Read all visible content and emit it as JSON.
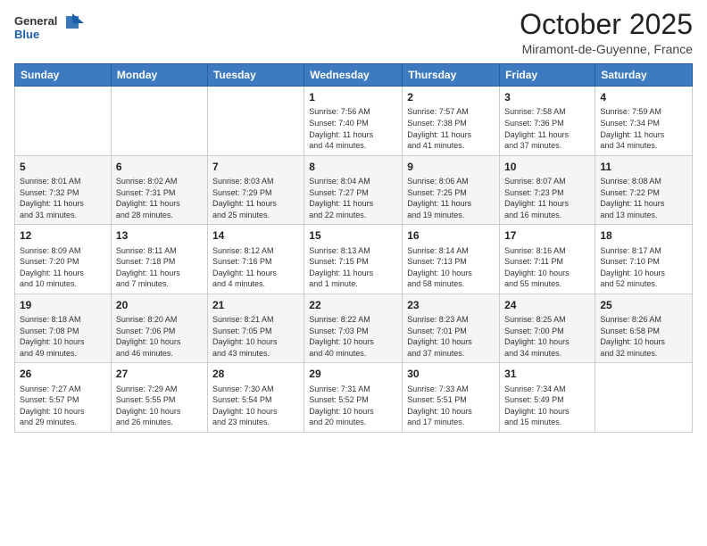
{
  "logo": {
    "general": "General",
    "blue": "Blue"
  },
  "header": {
    "month": "October 2025",
    "location": "Miramont-de-Guyenne, France"
  },
  "weekdays": [
    "Sunday",
    "Monday",
    "Tuesday",
    "Wednesday",
    "Thursday",
    "Friday",
    "Saturday"
  ],
  "weeks": [
    [
      {
        "day": "",
        "info": ""
      },
      {
        "day": "",
        "info": ""
      },
      {
        "day": "",
        "info": ""
      },
      {
        "day": "1",
        "info": "Sunrise: 7:56 AM\nSunset: 7:40 PM\nDaylight: 11 hours\nand 44 minutes."
      },
      {
        "day": "2",
        "info": "Sunrise: 7:57 AM\nSunset: 7:38 PM\nDaylight: 11 hours\nand 41 minutes."
      },
      {
        "day": "3",
        "info": "Sunrise: 7:58 AM\nSunset: 7:36 PM\nDaylight: 11 hours\nand 37 minutes."
      },
      {
        "day": "4",
        "info": "Sunrise: 7:59 AM\nSunset: 7:34 PM\nDaylight: 11 hours\nand 34 minutes."
      }
    ],
    [
      {
        "day": "5",
        "info": "Sunrise: 8:01 AM\nSunset: 7:32 PM\nDaylight: 11 hours\nand 31 minutes."
      },
      {
        "day": "6",
        "info": "Sunrise: 8:02 AM\nSunset: 7:31 PM\nDaylight: 11 hours\nand 28 minutes."
      },
      {
        "day": "7",
        "info": "Sunrise: 8:03 AM\nSunset: 7:29 PM\nDaylight: 11 hours\nand 25 minutes."
      },
      {
        "day": "8",
        "info": "Sunrise: 8:04 AM\nSunset: 7:27 PM\nDaylight: 11 hours\nand 22 minutes."
      },
      {
        "day": "9",
        "info": "Sunrise: 8:06 AM\nSunset: 7:25 PM\nDaylight: 11 hours\nand 19 minutes."
      },
      {
        "day": "10",
        "info": "Sunrise: 8:07 AM\nSunset: 7:23 PM\nDaylight: 11 hours\nand 16 minutes."
      },
      {
        "day": "11",
        "info": "Sunrise: 8:08 AM\nSunset: 7:22 PM\nDaylight: 11 hours\nand 13 minutes."
      }
    ],
    [
      {
        "day": "12",
        "info": "Sunrise: 8:09 AM\nSunset: 7:20 PM\nDaylight: 11 hours\nand 10 minutes."
      },
      {
        "day": "13",
        "info": "Sunrise: 8:11 AM\nSunset: 7:18 PM\nDaylight: 11 hours\nand 7 minutes."
      },
      {
        "day": "14",
        "info": "Sunrise: 8:12 AM\nSunset: 7:16 PM\nDaylight: 11 hours\nand 4 minutes."
      },
      {
        "day": "15",
        "info": "Sunrise: 8:13 AM\nSunset: 7:15 PM\nDaylight: 11 hours\nand 1 minute."
      },
      {
        "day": "16",
        "info": "Sunrise: 8:14 AM\nSunset: 7:13 PM\nDaylight: 10 hours\nand 58 minutes."
      },
      {
        "day": "17",
        "info": "Sunrise: 8:16 AM\nSunset: 7:11 PM\nDaylight: 10 hours\nand 55 minutes."
      },
      {
        "day": "18",
        "info": "Sunrise: 8:17 AM\nSunset: 7:10 PM\nDaylight: 10 hours\nand 52 minutes."
      }
    ],
    [
      {
        "day": "19",
        "info": "Sunrise: 8:18 AM\nSunset: 7:08 PM\nDaylight: 10 hours\nand 49 minutes."
      },
      {
        "day": "20",
        "info": "Sunrise: 8:20 AM\nSunset: 7:06 PM\nDaylight: 10 hours\nand 46 minutes."
      },
      {
        "day": "21",
        "info": "Sunrise: 8:21 AM\nSunset: 7:05 PM\nDaylight: 10 hours\nand 43 minutes."
      },
      {
        "day": "22",
        "info": "Sunrise: 8:22 AM\nSunset: 7:03 PM\nDaylight: 10 hours\nand 40 minutes."
      },
      {
        "day": "23",
        "info": "Sunrise: 8:23 AM\nSunset: 7:01 PM\nDaylight: 10 hours\nand 37 minutes."
      },
      {
        "day": "24",
        "info": "Sunrise: 8:25 AM\nSunset: 7:00 PM\nDaylight: 10 hours\nand 34 minutes."
      },
      {
        "day": "25",
        "info": "Sunrise: 8:26 AM\nSunset: 6:58 PM\nDaylight: 10 hours\nand 32 minutes."
      }
    ],
    [
      {
        "day": "26",
        "info": "Sunrise: 7:27 AM\nSunset: 5:57 PM\nDaylight: 10 hours\nand 29 minutes."
      },
      {
        "day": "27",
        "info": "Sunrise: 7:29 AM\nSunset: 5:55 PM\nDaylight: 10 hours\nand 26 minutes."
      },
      {
        "day": "28",
        "info": "Sunrise: 7:30 AM\nSunset: 5:54 PM\nDaylight: 10 hours\nand 23 minutes."
      },
      {
        "day": "29",
        "info": "Sunrise: 7:31 AM\nSunset: 5:52 PM\nDaylight: 10 hours\nand 20 minutes."
      },
      {
        "day": "30",
        "info": "Sunrise: 7:33 AM\nSunset: 5:51 PM\nDaylight: 10 hours\nand 17 minutes."
      },
      {
        "day": "31",
        "info": "Sunrise: 7:34 AM\nSunset: 5:49 PM\nDaylight: 10 hours\nand 15 minutes."
      },
      {
        "day": "",
        "info": ""
      }
    ]
  ]
}
